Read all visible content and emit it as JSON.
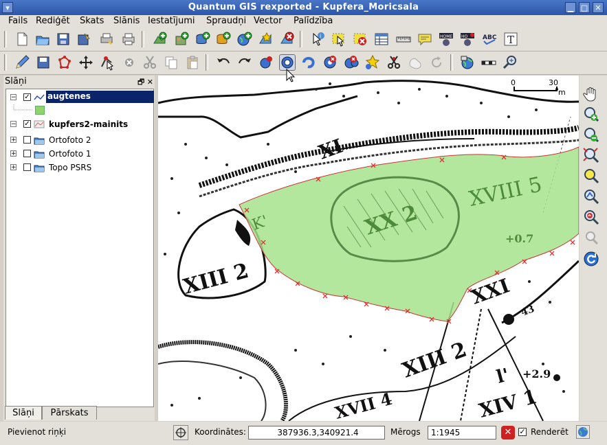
{
  "window": {
    "title": "Quantum GIS rexported - Kupfera_Moricsala"
  },
  "menubar": {
    "items": [
      "Fails",
      "Rediģēt",
      "Skats",
      "Slānis",
      "Iestatījumi",
      "Spraudņi",
      "Vector",
      "Palīdzība"
    ]
  },
  "toolbar1": {
    "icons": [
      "new-project-icon",
      "open-project-icon",
      "save-project-icon",
      "save-project-as-icon",
      "print-composer-icon",
      "print-icon",
      "add-vector-layer-icon",
      "add-raster-layer-icon",
      "add-postgis-layer-icon",
      "add-spatialite-layer-icon",
      "add-wms-layer-icon",
      "new-vector-layer-icon",
      "remove-layer-icon",
      "identify-icon",
      "select-features-icon",
      "deselect-icon",
      "attribute-table-icon",
      "measure-line-icon",
      "map-tips-icon",
      "home-icon",
      "home-alt-icon",
      "spell-check-icon",
      "text-annotation-icon"
    ]
  },
  "toolbar2": {
    "icons": [
      "toggle-editing-icon",
      "save-edits-icon",
      "capture-polygon-icon",
      "move-feature-icon",
      "node-tool-icon",
      "delete-selected-icon",
      "cut-features-icon",
      "copy-features-icon",
      "paste-features-icon",
      "undo-icon",
      "redo-icon",
      "simplify-feature-icon",
      "add-ring-icon",
      "add-part-icon",
      "delete-ring-icon",
      "delete-part-icon",
      "reshape-features-icon",
      "split-features-icon",
      "merge-features-icon",
      "rotate-icon",
      "gps-icon",
      "scale-bar-icon",
      "zoom-tool-icon"
    ]
  },
  "layers_panel": {
    "title": "Slāņi",
    "layers": [
      {
        "name": "augtenes",
        "checked": true,
        "selected": true,
        "expanded": true
      },
      {
        "name": "kupfers2-mainits",
        "checked": true,
        "selected": false,
        "expanded": true
      },
      {
        "name": "Ortofoto 2",
        "checked": false,
        "selected": false,
        "expanded": false
      },
      {
        "name": "Ortofoto 1",
        "checked": false,
        "selected": false,
        "expanded": false
      },
      {
        "name": "Topo PSRS",
        "checked": false,
        "selected": false,
        "expanded": false
      }
    ],
    "tabs": [
      "Slāņi",
      "Pārskats"
    ]
  },
  "map": {
    "scalebar_zero": "0",
    "scalebar_max": "30",
    "scalebar_unit": "m",
    "labels": [
      "XI",
      "XVIII 5",
      "XX 2",
      "K'",
      "+0.7",
      "XIII 2",
      "XXI",
      "43",
      "XIII 2",
      "l'",
      "+2.9",
      "XIV 1",
      "XVII 4"
    ],
    "polygon_color": "#a6e38c"
  },
  "status": {
    "message": "Pievienot riņķi",
    "coord_label": "Koordinātes:",
    "coord_value": "387936.3,340921.4",
    "scale_label": "Mērogs",
    "scale_value": "1:1945",
    "render_label": "Renderēt",
    "render_checked": true
  },
  "colors": {
    "titlebar": "#2c57a8",
    "selection": "#0a246a",
    "accent_polygon": "#a6e38c",
    "vertex": "#d33"
  }
}
